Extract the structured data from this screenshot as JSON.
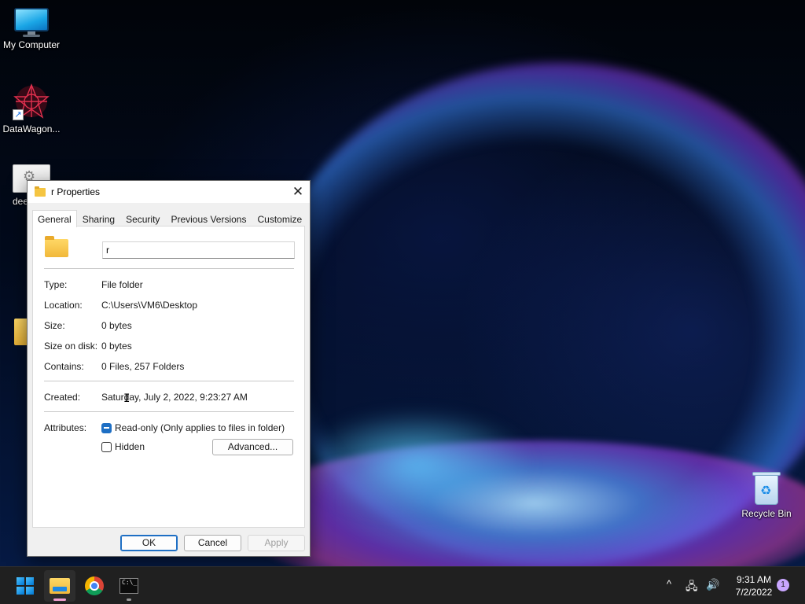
{
  "desktop": {
    "icons": {
      "my_computer": "My Computer",
      "datawagon": "DataWagon...",
      "dee": "dee",
      "recycle_bin": "Recycle Bin"
    }
  },
  "dialog": {
    "title": "r Properties",
    "close_glyph": "✕",
    "tabs": [
      "General",
      "Sharing",
      "Security",
      "Previous Versions",
      "Customize"
    ],
    "active_tab": "General",
    "folder_name": "r",
    "properties": {
      "type_label": "Type:",
      "type_value": "File folder",
      "location_label": "Location:",
      "location_value": "C:\\Users\\VM6\\Desktop",
      "size_label": "Size:",
      "size_value": "0 bytes",
      "size_on_disk_label": "Size on disk:",
      "size_on_disk_value": "0 bytes",
      "contains_label": "Contains:",
      "contains_value": "0 Files, 257 Folders",
      "created_label": "Created:",
      "created_value": "Saturday, July 2, 2022, 9:23:27 AM",
      "attributes_label": "Attributes:"
    },
    "attributes": {
      "readonly_label": "Read-only (Only applies to files in folder)",
      "readonly_state": "indeterminate",
      "hidden_label": "Hidden",
      "hidden_checked": false,
      "advanced_button": "Advanced..."
    },
    "buttons": {
      "ok": "OK",
      "cancel": "Cancel",
      "apply": "Apply"
    }
  },
  "taskbar": {
    "tray": {
      "chevron_glyph": "^",
      "network_glyph": "🖧",
      "volume_glyph": "🔊"
    },
    "clock": {
      "time": "9:31 AM",
      "date": "7/2/2022"
    },
    "notification_count": "1"
  },
  "colors": {
    "accent": "#1e6fc4",
    "taskbar_bg": "#202020",
    "dialog_bg": "#f0f0f0",
    "explorer_indicator": "#f0a0d0",
    "terminal_indicator": "#9a9a9a"
  }
}
